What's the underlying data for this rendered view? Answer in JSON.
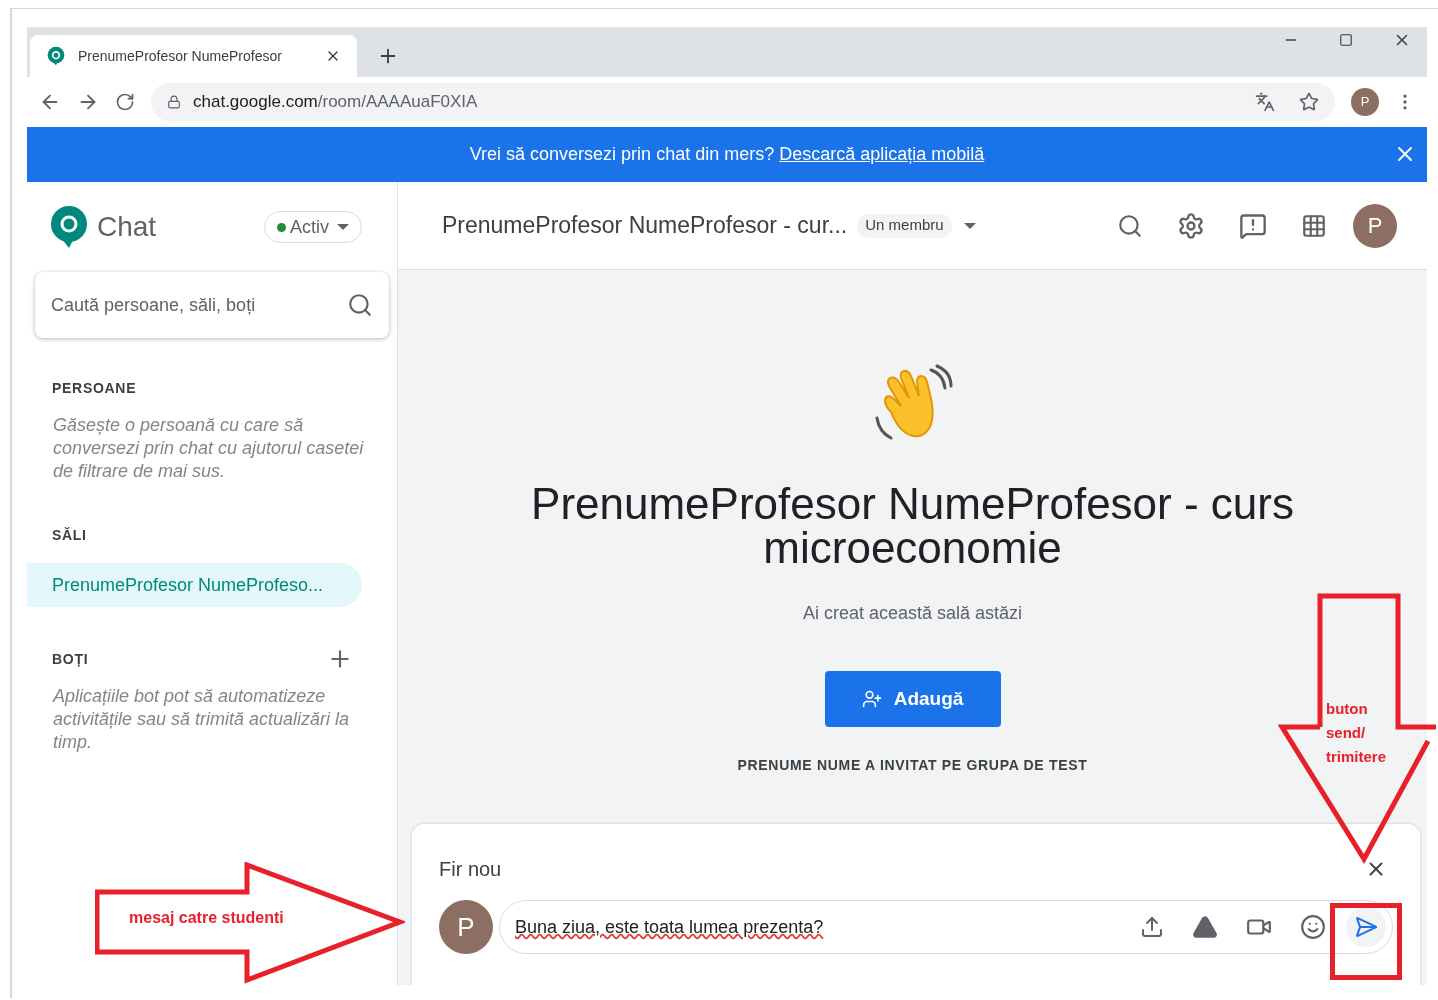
{
  "browser": {
    "tab_title": "PrenumeProfesor NumeProfesor",
    "url_host": "chat.google.com",
    "url_path": "/room/AAAAuaF0XIA",
    "profile_initial": "P"
  },
  "banner": {
    "text": "Vrei să conversezi prin chat din mers?",
    "link": "Descarcă aplicația mobilă"
  },
  "sidebar": {
    "app_name": "Chat",
    "status": "Activ",
    "search": {
      "placeholder": "Caută persoane, săli, boți"
    },
    "sections": [
      {
        "heading": "PERSOANE",
        "hint": "Găsește o persoană cu care să conversezi prin chat cu ajutorul casetei de filtrare de mai sus."
      },
      {
        "heading": "SĂLI",
        "items": [
          {
            "label": "PrenumeProfesor NumeProfeso...",
            "selected": true
          }
        ]
      },
      {
        "heading": "BOȚI",
        "add": true,
        "hint": "Aplicațiile bot pot să automatizeze activitățile sau să trimită actualizări la timp."
      }
    ]
  },
  "header": {
    "title": "PrenumeProfesor NumeProfesor - cur...",
    "members": "Un membru",
    "avatar": "P"
  },
  "welcome": {
    "title": "PrenumeProfesor NumeProfesor - curs microeconomie",
    "subtitle": "Ai creat această sală astăzi",
    "add_button": "Adaugă",
    "note": "PRENUME NUME A INVITAT PE GRUPA DE TEST"
  },
  "composer": {
    "title": "Fir nou",
    "avatar": "P",
    "value": "Buna ziua, este toata lumea prezenta?"
  },
  "annotations": [
    {
      "kind": "right-arrow",
      "text": "mesaj catre studenti"
    },
    {
      "kind": "down-arrow",
      "text": "buton send/ trimitere"
    },
    {
      "kind": "highlight-box"
    }
  ]
}
